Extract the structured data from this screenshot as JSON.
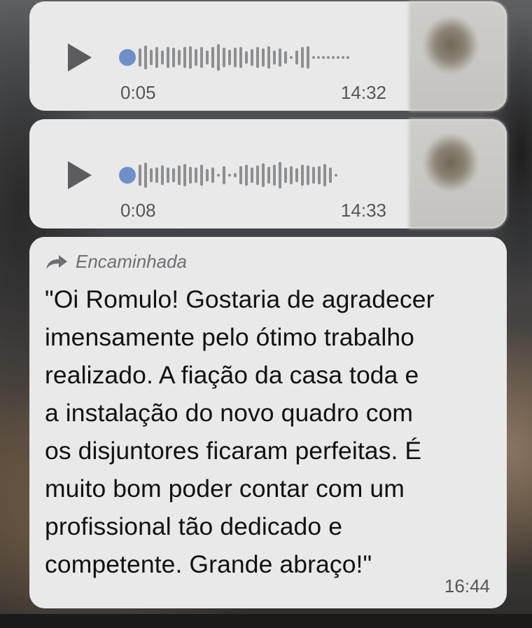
{
  "messages": {
    "audio": [
      {
        "duration": "0:05",
        "time": "14:32",
        "progress": 0
      },
      {
        "duration": "0:08",
        "time": "14:33",
        "progress": 0
      }
    ],
    "text_message": {
      "forwarded_label": "Encaminhada",
      "body": "\"Oi Romulo! Gostaria de agradecer\nimensamente pelo ótimo trabalho\nrealizado. A fiação da casa toda e\na instalação do novo quadro com\nos disjuntores ficaram perfeitas. É\nmuito bom poder contar com um\nprofissional tão dedicado e\ncompetente.  Grande abraço!\"",
      "time": "16:44"
    }
  },
  "icons": {
    "play": "play-icon",
    "forward": "forward-arrow-icon",
    "avatar": "blurred-avatar"
  },
  "colors": {
    "bubble": "#e9e9ea",
    "waveform_progress_dot": "#6f8fc8",
    "waveform": "#8d8e90",
    "secondary_text": "#555555"
  }
}
